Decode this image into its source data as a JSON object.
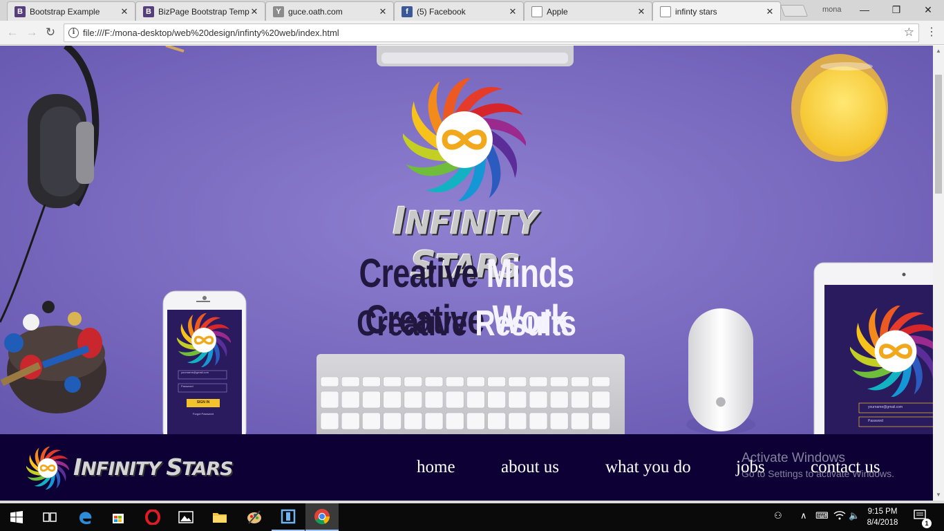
{
  "browser": {
    "tabs": [
      {
        "title": "Bootstrap Example",
        "favicon": "B",
        "favicon_color": "#563d7c"
      },
      {
        "title": "BizPage Bootstrap Temp",
        "favicon": "B",
        "favicon_color": "#563d7c"
      },
      {
        "title": "guce.oath.com",
        "favicon": "Y",
        "favicon_color": "#8c8c8c"
      },
      {
        "title": "(5) Facebook",
        "favicon": "f",
        "favicon_color": "#3b5998"
      },
      {
        "title": "Apple",
        "favicon": "page-icon",
        "favicon_color": "#ffffff"
      },
      {
        "title": "infinty stars",
        "favicon": "page-icon",
        "favicon_color": "#ffffff"
      }
    ],
    "active_tab": 5,
    "close_glyph": "✕",
    "profile_name": "mona",
    "url": "file:///F:/mona-desktop/web%20design/infinty%20web/index.html"
  },
  "hero": {
    "brand_first_letter": "I",
    "brand_rest_1": "NFINITY ",
    "brand_second_letter": "S",
    "brand_rest_2": "TARS",
    "tagline_1": [
      {
        "text": "Creative ",
        "tone": "dark"
      },
      {
        "text": "Minds  ",
        "tone": "light"
      },
      {
        "text": "Creative ",
        "tone": "dark"
      },
      {
        "text": "Work",
        "tone": "light"
      }
    ],
    "tagline_2": [
      {
        "text": "Creative ",
        "tone": "dark"
      },
      {
        "text": "Results",
        "tone": "light"
      }
    ],
    "phone_fields": {
      "email": "yourname@gmail.com",
      "password": "Password",
      "button": "SIGN IN",
      "forgot": "Forgot Password"
    },
    "tablet_fields": {
      "email": "yourname@gmail.com",
      "password": "Password"
    }
  },
  "navbar": {
    "brand_first_letter": "I",
    "brand_rest_1": "NFINITY ",
    "brand_second_letter": "S",
    "brand_rest_2": "TARS",
    "links": [
      "home",
      "about us",
      "what you do",
      "jobs",
      "contact us"
    ]
  },
  "watermark": {
    "line1": "Activate Windows",
    "line2": "Go to Settings to activate Windows."
  },
  "taskbar": {
    "time": "9:15 PM",
    "date": "8/4/2018",
    "notification_count": "1",
    "apps": [
      "start-icon",
      "task-view-icon",
      "edge-icon",
      "store-icon",
      "opera-icon",
      "photos-icon",
      "file-explorer-icon",
      "paint-icon",
      "app-icon",
      "chrome-icon"
    ]
  },
  "colors": {
    "hero_purple": "#7c6dc2",
    "navbar_bg": "#0d0035",
    "tagline_dark": "#22173f"
  }
}
